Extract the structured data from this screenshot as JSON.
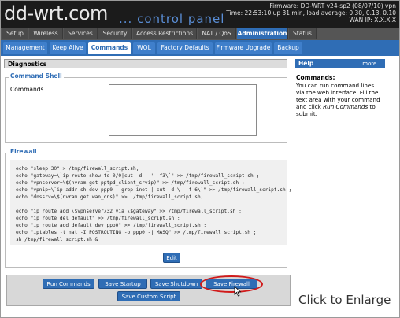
{
  "header": {
    "logo": "dd-wrt.com",
    "tagline": "... control panel",
    "firmware": "Firmware: DD-WRT v24-sp2 (08/07/10) vpn",
    "time": "Time: 22:53:10 up 31 min, load average: 0.30, 0.13, 0.10",
    "wan_ip": "WAN IP: X.X.X.X"
  },
  "main_tabs": [
    "Setup",
    "Wireless",
    "Services",
    "Security",
    "Access Restrictions",
    "NAT / QoS",
    "Administration",
    "Status"
  ],
  "sub_tabs": [
    "Management",
    "Keep Alive",
    "Commands",
    "WOL",
    "Factory Defaults",
    "Firmware Upgrade",
    "Backup"
  ],
  "diagnostics": {
    "title": "Diagnostics",
    "command_shell_legend": "Command Shell",
    "commands_label": "Commands",
    "commands_value": ""
  },
  "firewall": {
    "legend": "Firewall",
    "lines": [
      "echo \"sleep 30\" > /tmp/firewall_script.sh;",
      "echo \"gateway=\\`ip route show to 0/0|cut -d ' ' -f3\\`\" >> /tmp/firewall_script.sh ;",
      "echo \"vpnserver=\\$(nvram get pptpd_client_srvip)\" >> /tmp/firewall_script.sh ;",
      "echo \"vpnip=\\`ip addr sh dev ppp0 | grep inet | cut -d \\  -f 6\\`\" >> /tmp/firewall_script.sh ;",
      "echo \"dnssrv=\\$(nvram get wan_dns)\" >>  /tmp/firewall_script.sh;",
      "",
      "echo \"ip route add \\$vpnserver/32 via \\$gateway\" >> /tmp/firewall_script.sh ;",
      "echo \"ip route del default\" >> /tmp/firewall_script.sh ;",
      "echo \"ip route add default dev ppp0\" >> /tmp/firewall_script.sh ;",
      "echo \"iptables -t nat -I POSTROUTING -o ppp0 -j MASQ\" >> /tmp/firewall_script.sh ;",
      "sh /tmp/firewall_script.sh &"
    ],
    "edit_label": "Edit"
  },
  "buttons": {
    "run": "Run Commands",
    "save_startup": "Save Startup",
    "save_shutdown": "Save Shutdown",
    "save_firewall": "Save Firewall",
    "save_custom": "Save Custom Script"
  },
  "help": {
    "title": "Help",
    "more": "more...",
    "heading": "Commands:",
    "text_before": "You can run command lines via the web interface. Fill the text area with your command and click ",
    "text_emph": "Run Commands",
    "text_after": " to submit."
  },
  "caption": "Click to Enlarge",
  "colors": {
    "header_bg": "#1b1b1b",
    "accent": "#2f6db5",
    "highlight_ring": "#d11a1a"
  }
}
